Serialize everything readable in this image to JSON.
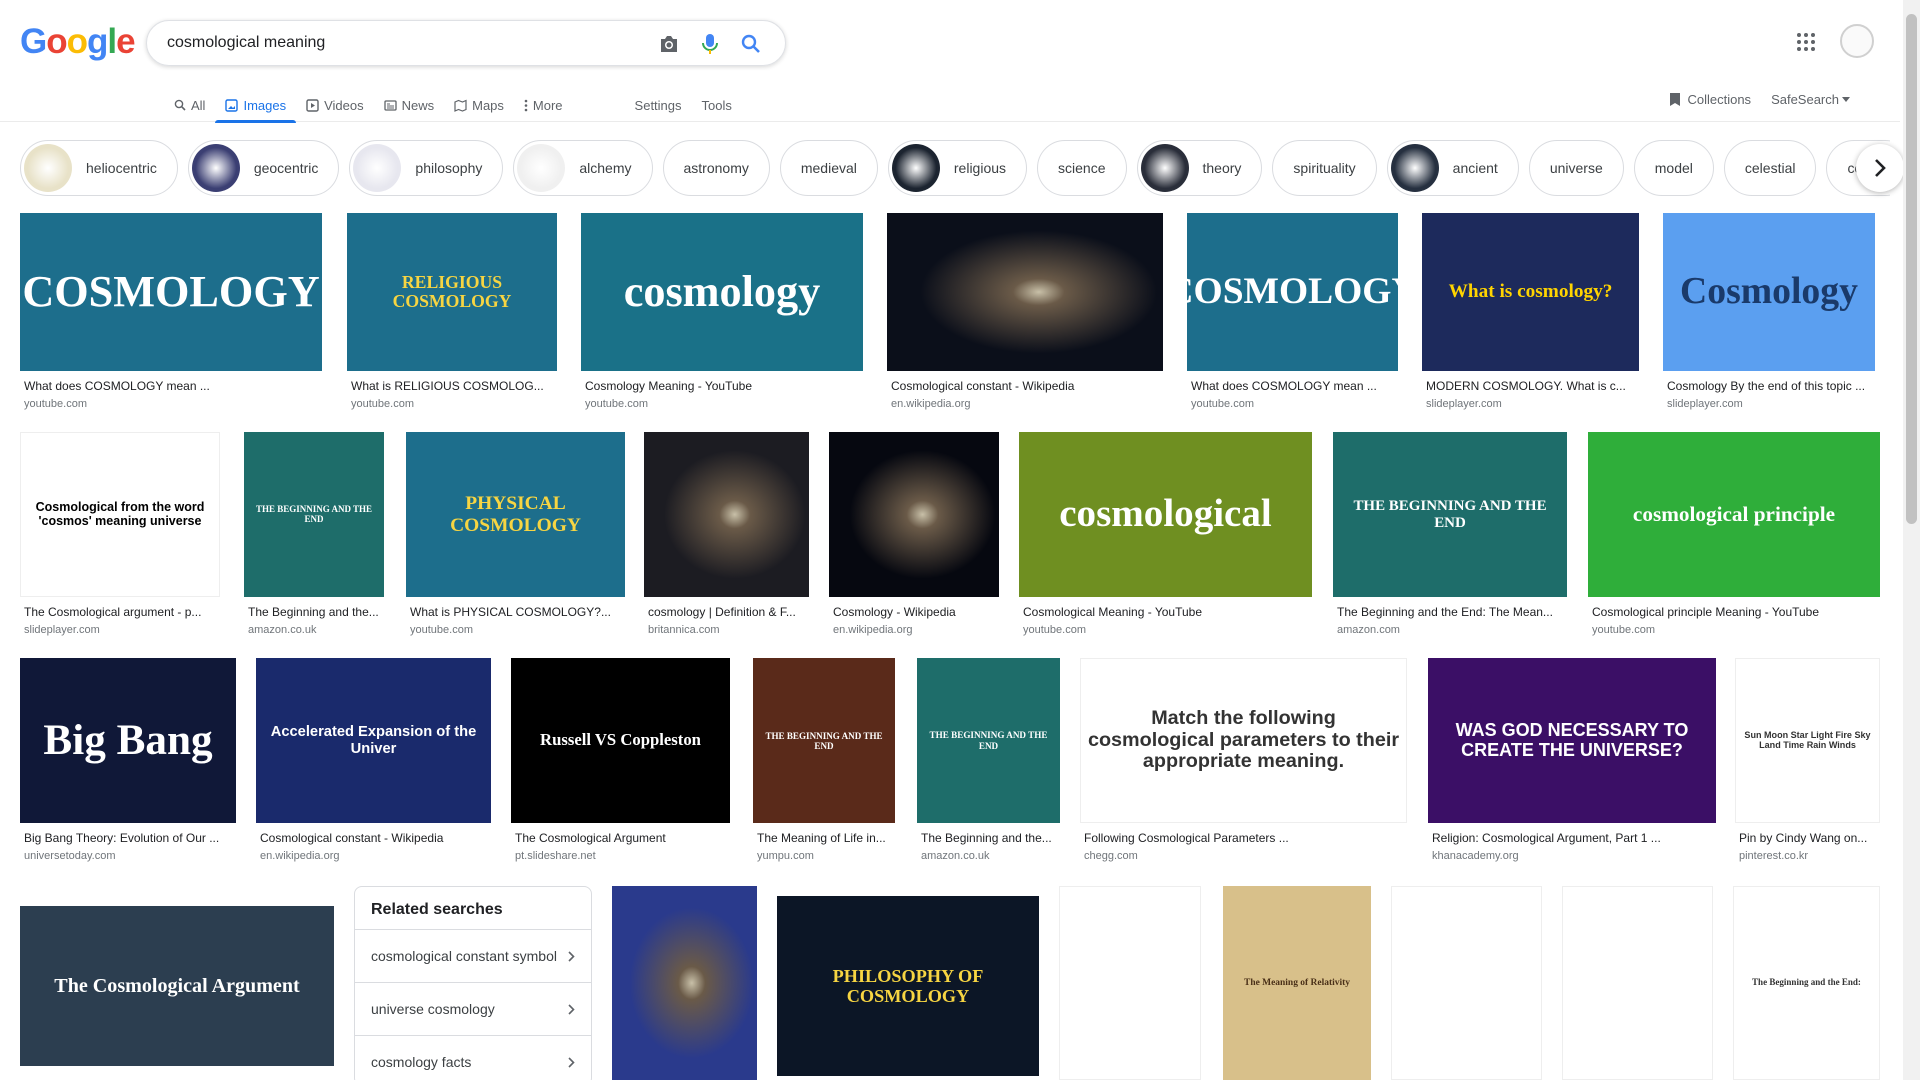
{
  "logo": {
    "text": "Google",
    "letters": [
      "G",
      "o",
      "o",
      "g",
      "l",
      "e"
    ],
    "colors": [
      "#4285f4",
      "#ea4335",
      "#fbbc05",
      "#4285f4",
      "#34a853",
      "#ea4335"
    ]
  },
  "search": {
    "query": "cosmological meaning"
  },
  "icons": {
    "camera": "camera-icon",
    "mic": "mic-icon",
    "search": "search-icon",
    "apps": "apps-grid-icon",
    "chevron": "chevron-right-icon"
  },
  "tabs": [
    {
      "label": "All",
      "icon": "search-icon"
    },
    {
      "label": "Images",
      "icon": "image-icon"
    },
    {
      "label": "Videos",
      "icon": "play-icon"
    },
    {
      "label": "News",
      "icon": "news-icon"
    },
    {
      "label": "Maps",
      "icon": "map-icon"
    },
    {
      "label": "More",
      "icon": "more-icon"
    }
  ],
  "settings_label": "Settings",
  "tools_label": "Tools",
  "collections_label": "Collections",
  "safesearch_label": "SafeSearch",
  "chips": [
    {
      "label": "heliocentric",
      "img": "#e8e2c8"
    },
    {
      "label": "geocentric",
      "img": "#3b3f73"
    },
    {
      "label": "philosophy",
      "img": "#e7e7ef"
    },
    {
      "label": "alchemy",
      "img": "#f0f0f0"
    },
    {
      "label": "astronomy"
    },
    {
      "label": "medieval"
    },
    {
      "label": "religious",
      "img": "#1c2430"
    },
    {
      "label": "science"
    },
    {
      "label": "theory",
      "img": "#2a2e3a"
    },
    {
      "label": "spirituality"
    },
    {
      "label": "ancient",
      "img": "#263040"
    },
    {
      "label": "universe"
    },
    {
      "label": "model"
    },
    {
      "label": "celestial"
    },
    {
      "label": "cosmol"
    }
  ],
  "results": [
    {
      "caption": "What does COSMOLOGY mean ...",
      "source": "youtube.com",
      "art": "COSMOLOGY",
      "bg": "#1d6e8c",
      "fg": "#ffffff"
    },
    {
      "caption": "What is RELIGIOUS COSMOLOG...",
      "source": "youtube.com",
      "art": "RELIGIOUS COSMOLOGY",
      "bg": "#1d6e8c",
      "fg": "#f7d542"
    },
    {
      "caption": "Cosmology Meaning - YouTube",
      "source": "youtube.com",
      "art": "cosmology",
      "bg": "#1a7188",
      "fg": "#ffffff"
    },
    {
      "caption": "Cosmological constant - Wikipedia",
      "source": "en.wikipedia.org",
      "art": "",
      "bg": "#0b0f1a",
      "fg": "#ffffff"
    },
    {
      "caption": "What does COSMOLOGY mean ...",
      "source": "youtube.com",
      "art": "COSMOLOGY",
      "bg": "#1d6e8c",
      "fg": "#ffffff"
    },
    {
      "caption": "MODERN COSMOLOGY. What is c...",
      "source": "slideplayer.com",
      "art": "What is cosmology?",
      "bg": "#1d2a5c",
      "fg": "#ffd400"
    },
    {
      "caption": "Cosmology By the end of this topic ...",
      "source": "slideplayer.com",
      "art": "Cosmology",
      "bg": "#5b9ff0",
      "fg": "#1a3a6a"
    },
    {
      "caption": "The Cosmological argument - p...",
      "source": "slideplayer.com",
      "art": "Cosmological from the word 'cosmos' meaning universe",
      "bg": "#ffffff",
      "fg": "#000000"
    },
    {
      "caption": "The Beginning and the...",
      "source": "amazon.co.uk",
      "art": "THE BEGINNING AND THE END",
      "bg": "#1e6d6a",
      "fg": "#ffffff"
    },
    {
      "caption": "What is PHYSICAL COSMOLOGY?...",
      "source": "youtube.com",
      "art": "PHYSICAL COSMOLOGY",
      "bg": "#1d6e8c",
      "fg": "#f7d542"
    },
    {
      "caption": "cosmology | Definition & F...",
      "source": "britannica.com",
      "art": "",
      "bg": "#1c1c22",
      "fg": "#ffffff"
    },
    {
      "caption": "Cosmology - Wikipedia",
      "source": "en.wikipedia.org",
      "art": "",
      "bg": "#060810",
      "fg": "#ffffff"
    },
    {
      "caption": "Cosmological Meaning - YouTube",
      "source": "youtube.com",
      "art": "cosmological",
      "bg": "#6f8f21",
      "fg": "#ffffff"
    },
    {
      "caption": "The Beginning and the End: The Mean...",
      "source": "amazon.com",
      "art": "THE BEGINNING AND THE END",
      "bg": "#1e6d6a",
      "fg": "#ffffff"
    },
    {
      "caption": "Cosmological principle Meaning - YouTube",
      "source": "youtube.com",
      "art": "cosmological principle",
      "bg": "#2fae3a",
      "fg": "#ffffff"
    },
    {
      "caption": "Big Bang Theory: Evolution of Our ...",
      "source": "universetoday.com",
      "art": "Big Bang",
      "bg": "#101838",
      "fg": "#ffffff"
    },
    {
      "caption": "Cosmological constant - Wikipedia",
      "source": "en.wikipedia.org",
      "art": "Accelerated Expansion of the Univer",
      "bg": "#1a2a6c",
      "fg": "#ffffff"
    },
    {
      "caption": "The Cosmological Argument",
      "source": "pt.slideshare.net",
      "art": "Russell VS Coppleston",
      "bg": "#000000",
      "fg": "#ffffff"
    },
    {
      "caption": "The Meaning of Life in...",
      "source": "yumpu.com",
      "art": "THE BEGINNING AND THE END",
      "bg": "#5a2a1a",
      "fg": "#ffffff"
    },
    {
      "caption": "The Beginning and the...",
      "source": "amazon.co.uk",
      "art": "THE BEGINNING AND THE END",
      "bg": "#1e6d6a",
      "fg": "#ffffff"
    },
    {
      "caption": "Following Cosmological Parameters ...",
      "source": "chegg.com",
      "art": "Match the following cosmological parameters to their appropriate meaning.",
      "bg": "#ffffff",
      "fg": "#333333"
    },
    {
      "caption": "Religion: Cosmological Argument, Part 1 ...",
      "source": "khanacademy.org",
      "art": "WAS GOD NECESSARY TO CREATE THE UNIVERSE?",
      "bg": "#3b0f66",
      "fg": "#ffffff"
    },
    {
      "caption": "Pin by Cindy Wang on...",
      "source": "pinterest.co.kr",
      "art": "Sun Moon Star Light Fire Sky Land Time Rain Winds",
      "bg": "#ffffff",
      "fg": "#333333"
    },
    {
      "caption": "",
      "source": "",
      "art": "The Cosmological Argument",
      "bg": "#2c3e50",
      "fg": "#ffffff"
    },
    {
      "caption": "",
      "source": "",
      "art": "",
      "bg": "#2a3a8c",
      "fg": "#ffffff"
    },
    {
      "caption": "",
      "source": "",
      "art": "PHILOSOPHY OF COSMOLOGY",
      "bg": "#0c1626",
      "fg": "#f7d542"
    },
    {
      "caption": "",
      "source": "",
      "art": "",
      "bg": "#ffffff",
      "fg": "#333333"
    },
    {
      "caption": "",
      "source": "",
      "art": "The Meaning of Relativity",
      "bg": "#d8c08a",
      "fg": "#4a3018"
    },
    {
      "caption": "",
      "source": "",
      "art": "",
      "bg": "#ffffff",
      "fg": "#333333"
    },
    {
      "caption": "",
      "source": "",
      "art": "",
      "bg": "#ffffff",
      "fg": "#333333"
    },
    {
      "caption": "",
      "source": "",
      "art": "The Beginning and the End:",
      "bg": "#ffffff",
      "fg": "#333333"
    }
  ],
  "related": {
    "title": "Related searches",
    "items": [
      "cosmological constant symbol",
      "universe cosmology",
      "cosmology facts"
    ]
  }
}
